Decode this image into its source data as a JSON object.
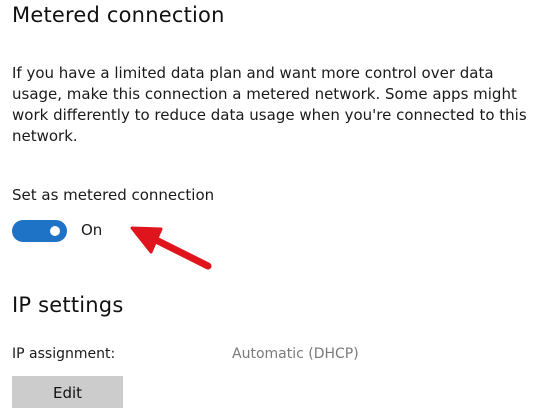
{
  "metered": {
    "title": "Metered connection",
    "description": "If you have a limited data plan and want more control over data usage, make this connection a metered network. Some apps might work differently to reduce data usage when you're connected to this network.",
    "setting_label": "Set as metered connection",
    "toggle_state": "On",
    "toggle_on": true,
    "toggle_color": "#1f73c7"
  },
  "annotation": {
    "arrow_color": "#e0141c",
    "icon": "red-arrow-icon"
  },
  "ip": {
    "title": "IP settings",
    "assignment_label": "IP assignment:",
    "assignment_value": "Automatic (DHCP)",
    "edit_label": "Edit"
  }
}
